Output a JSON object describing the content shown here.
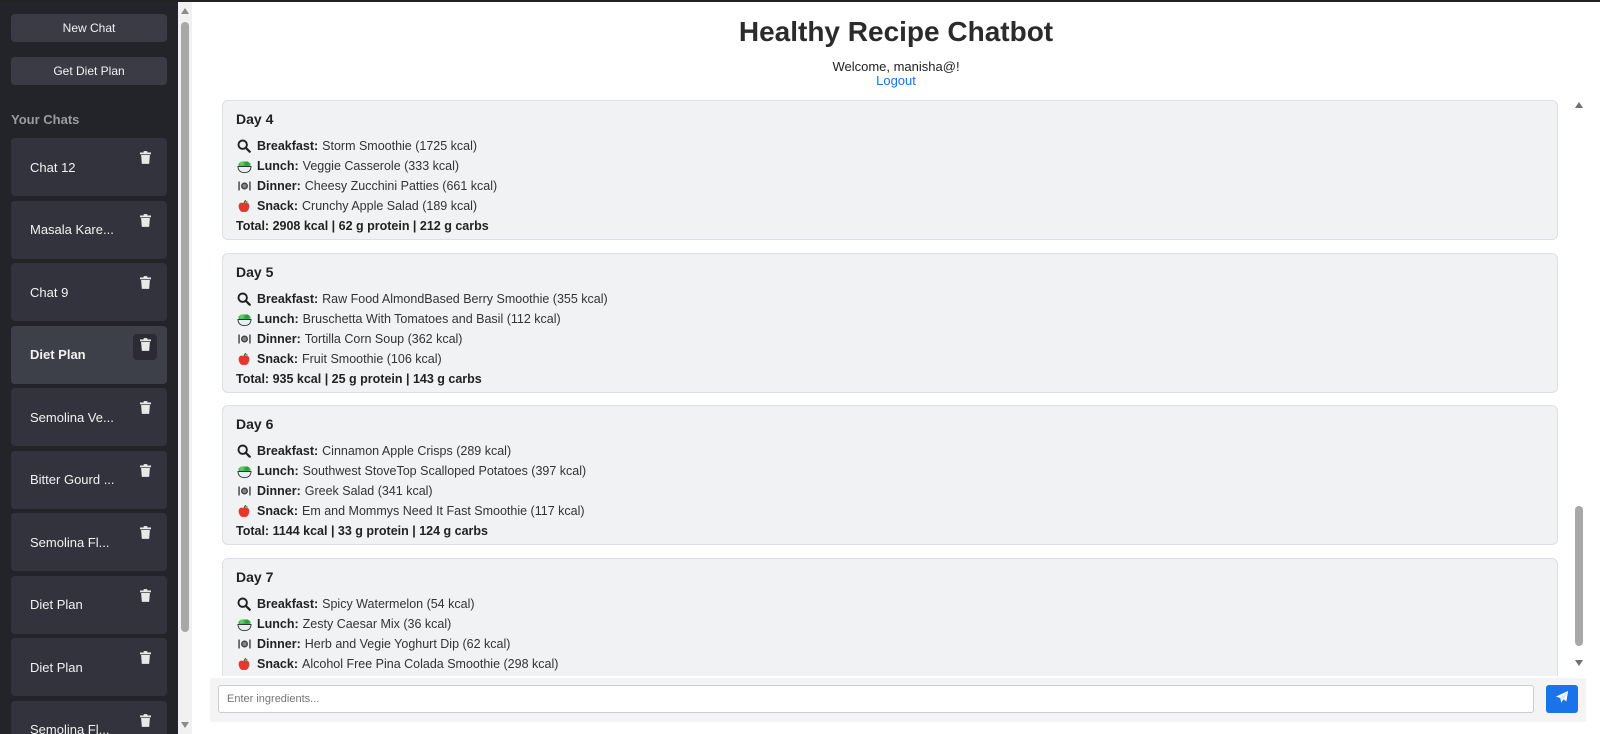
{
  "sidebar": {
    "new_chat": "New Chat",
    "get_diet_plan": "Get Diet Plan",
    "chats_title": "Your Chats",
    "chats": [
      {
        "label": "Chat 12",
        "active": false
      },
      {
        "label": "Masala Kare...",
        "active": false
      },
      {
        "label": "Chat 9",
        "active": false
      },
      {
        "label": "Diet Plan",
        "active": true
      },
      {
        "label": "Semolina Ve...",
        "active": false
      },
      {
        "label": "Bitter Gourd ...",
        "active": false
      },
      {
        "label": "Semolina Fl...",
        "active": false
      },
      {
        "label": "Diet Plan",
        "active": false
      },
      {
        "label": "Diet Plan",
        "active": false
      },
      {
        "label": "Semolina Fl...",
        "active": false
      }
    ]
  },
  "header": {
    "title": "Healthy Recipe Chatbot",
    "welcome": "Welcome, manisha@!",
    "logout": "Logout"
  },
  "days": [
    {
      "title": "Day 4",
      "meals": [
        {
          "label": "Breakfast:",
          "text": "Storm Smoothie (1725 kcal)",
          "icon": "magnifier-icon"
        },
        {
          "label": "Lunch:",
          "text": "Veggie Casserole (333 kcal)",
          "icon": "salad-bowl-icon"
        },
        {
          "label": "Dinner:",
          "text": "Cheesy Zucchini Patties (661 kcal)",
          "icon": "fork-knife-plate-icon"
        },
        {
          "label": "Snack:",
          "text": "Crunchy Apple Salad (189 kcal)",
          "icon": "apple-icon"
        }
      ],
      "total": "Total: 2908 kcal | 62 g protein | 212 g carbs"
    },
    {
      "title": "Day 5",
      "meals": [
        {
          "label": "Breakfast:",
          "text": "Raw Food AlmondBased Berry Smoothie (355 kcal)",
          "icon": "magnifier-icon"
        },
        {
          "label": "Lunch:",
          "text": "Bruschetta With Tomatoes and Basil (112 kcal)",
          "icon": "salad-bowl-icon"
        },
        {
          "label": "Dinner:",
          "text": "Tortilla Corn Soup (362 kcal)",
          "icon": "fork-knife-plate-icon"
        },
        {
          "label": "Snack:",
          "text": "Fruit Smoothie (106 kcal)",
          "icon": "apple-icon"
        }
      ],
      "total": "Total: 935 kcal | 25 g protein | 143 g carbs"
    },
    {
      "title": "Day 6",
      "meals": [
        {
          "label": "Breakfast:",
          "text": "Cinnamon Apple Crisps (289 kcal)",
          "icon": "magnifier-icon"
        },
        {
          "label": "Lunch:",
          "text": "Southwest StoveTop Scalloped Potatoes (397 kcal)",
          "icon": "salad-bowl-icon"
        },
        {
          "label": "Dinner:",
          "text": "Greek Salad (341 kcal)",
          "icon": "fork-knife-plate-icon"
        },
        {
          "label": "Snack:",
          "text": "Em and Mommys Need It Fast Smoothie (117 kcal)",
          "icon": "apple-icon"
        }
      ],
      "total": "Total: 1144 kcal | 33 g protein | 124 g carbs"
    },
    {
      "title": "Day 7",
      "meals": [
        {
          "label": "Breakfast:",
          "text": "Spicy Watermelon (54 kcal)",
          "icon": "magnifier-icon"
        },
        {
          "label": "Lunch:",
          "text": "Zesty Caesar Mix (36 kcal)",
          "icon": "salad-bowl-icon"
        },
        {
          "label": "Dinner:",
          "text": "Herb and Vegie Yoghurt Dip (62 kcal)",
          "icon": "fork-knife-plate-icon"
        },
        {
          "label": "Snack:",
          "text": "Alcohol Free Pina Colada Smoothie (298 kcal)",
          "icon": "apple-icon"
        }
      ],
      "total": ""
    }
  ],
  "input": {
    "placeholder": "Enter ingredients...",
    "value": ""
  },
  "send_icon": "paper-plane-icon",
  "colors": {
    "sidebar_bg": "#23242a",
    "accent": "#1a73e8"
  }
}
